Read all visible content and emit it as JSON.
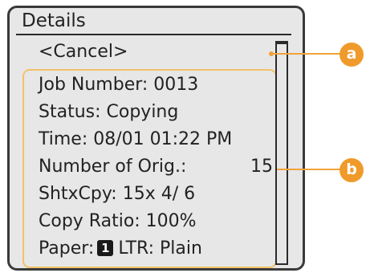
{
  "screen": {
    "title": "Details",
    "cancel_label": "<Cancel>"
  },
  "details": {
    "job_number": "Job Number: 0013",
    "status": "Status: Copying",
    "time": "Time: 08/01 01:22 PM",
    "orig_label": "Number of Orig.:",
    "orig_value": "15",
    "sheets_copies": "ShtxCpy: 15x 4/ 6",
    "copy_ratio": "Copy Ratio: 100%",
    "paper_label": "Paper:",
    "paper_tray": "1",
    "paper_value": "LTR: Plain"
  },
  "callouts": {
    "a": "a",
    "b": "b"
  },
  "colors": {
    "accent": "#ef9a2a",
    "panel_background": "#e7e7e7",
    "frame": "#3a3a3a",
    "highlight_border": "#f2c16a"
  }
}
